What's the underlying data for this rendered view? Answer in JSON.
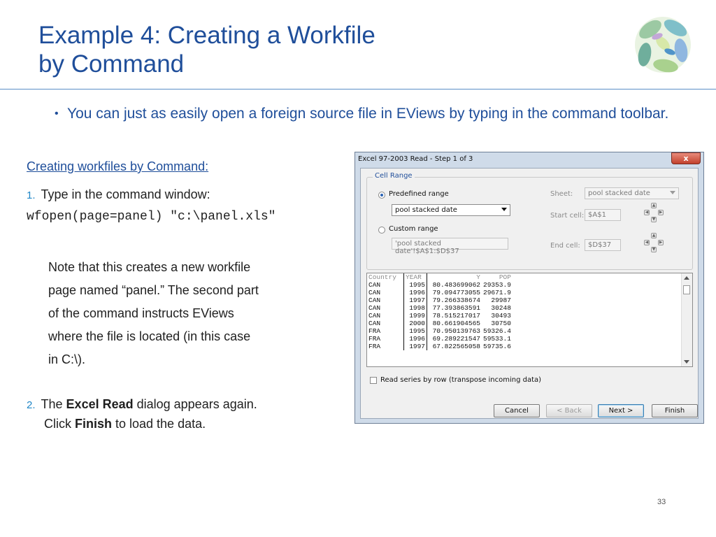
{
  "slide": {
    "title_line1": "Example 4: Creating a Workfile",
    "title_line2": "by Command",
    "bullet": "You can just as easily open a foreign source file in EViews by typing in the command toolbar.",
    "section_heading": "Creating workfiles by Command:",
    "step1_number": "1.",
    "step1_text": "Type in the command window:",
    "command": "wfopen(page=panel) \"c:\\panel.xls\"",
    "note_lines": [
      "Note that this creates a new workfile",
      "page named “panel.” The second part",
      "of the command instructs EViews",
      "where the file is located (in this case",
      "in C:\\)."
    ],
    "step2_number": "2.",
    "step2_pre": "The ",
    "step2_bold1": "Excel Read",
    "step2_mid": " dialog appears again.",
    "step2_pre2": "Click ",
    "step2_bold2": "Finish",
    "step2_post": " to load the data.",
    "page_number": "33"
  },
  "dialog": {
    "title": "Excel 97-2003 Read - Step 1 of 3",
    "close_glyph": "x",
    "cell_range_label": "Cell Range",
    "predefined_label": "Predefined range",
    "predefined_value": "pool stacked date",
    "custom_label": "Custom range",
    "custom_value": "'pool stacked date'!$A$1:$D$37",
    "sheet_label": "Sheet:",
    "sheet_value": "pool stacked date",
    "start_cell_label": "Start cell:",
    "start_cell_value": "$A$1",
    "end_cell_label": "End cell:",
    "end_cell_value": "$D$37",
    "grid_headers": [
      "Country",
      "YEAR",
      "Y",
      "POP"
    ],
    "grid_rows": [
      [
        "CAN",
        "1995",
        "80.483699062",
        "29353.9"
      ],
      [
        "CAN",
        "1996",
        "79.094773055",
        "29671.9"
      ],
      [
        "CAN",
        "1997",
        "79.266338674",
        "29987"
      ],
      [
        "CAN",
        "1998",
        "77.393863591",
        "30248"
      ],
      [
        "CAN",
        "1999",
        "78.515217017",
        "30493"
      ],
      [
        "CAN",
        "2000",
        "80.661904565",
        "30750"
      ],
      [
        "FRA",
        "1995",
        "70.950139763",
        "59326.4"
      ],
      [
        "FRA",
        "1996",
        "69.289221547",
        "59533.1"
      ],
      [
        "FRA",
        "1997",
        "67.822565058",
        "59735.6"
      ]
    ],
    "transpose_label": "Read series by row (transpose incoming data)",
    "buttons": {
      "cancel": "Cancel",
      "back": "< Back",
      "next": "Next >",
      "finish": "Finish"
    }
  },
  "colors": {
    "title_blue": "#1f4e9a",
    "rule": "#5a8fc7",
    "numbering": "#1f86c7"
  }
}
